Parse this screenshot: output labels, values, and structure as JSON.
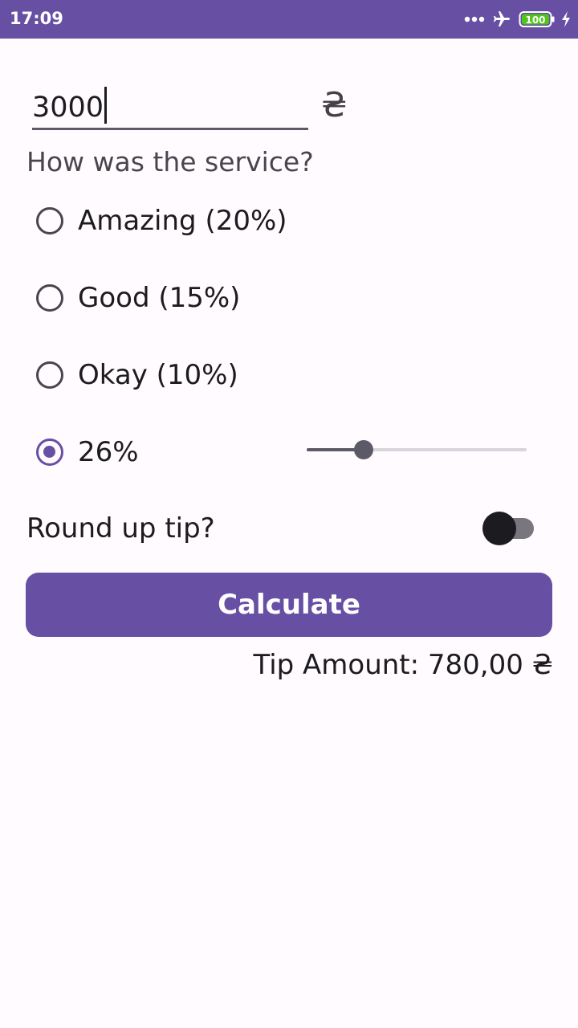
{
  "status_bar": {
    "time": "17:09",
    "battery_level": "100",
    "background_color": "#6750a4",
    "battery_color": "#52c41a",
    "icons": [
      "more-dots-icon",
      "airplane-mode-icon",
      "battery-icon",
      "charging-bolt-icon"
    ]
  },
  "form": {
    "amount_value": "3000",
    "currency_symbol": "₴",
    "service_question": "How was the service?",
    "options": [
      {
        "label": "Amazing (20%)",
        "checked": false
      },
      {
        "label": "Good (15%)",
        "checked": false
      },
      {
        "label": "Okay (10%)",
        "checked": false
      },
      {
        "label": "26%",
        "checked": true
      }
    ],
    "custom_slider_fraction": 0.26,
    "round_up_label": "Round up tip?",
    "round_up_enabled": false,
    "calculate_label": "Calculate",
    "tip_result": "Tip Amount: 780,00 ₴"
  },
  "colors": {
    "accent": "#6750a4",
    "background": "#fffbfe",
    "text": "#1c1b1f",
    "secondary_text": "#49454f"
  }
}
